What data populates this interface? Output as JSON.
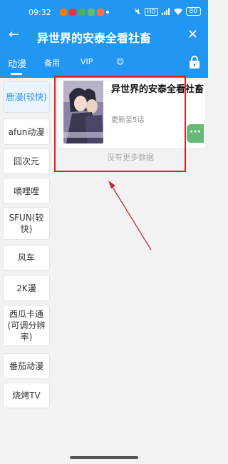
{
  "status_bar": {
    "time": "09:32",
    "battery": "80",
    "hd_label": "HD",
    "app_icon_colors": [
      "#f57c00",
      "#e53935",
      "#4caf50",
      "#66bb6a",
      "#ff7043",
      "#ffffff"
    ]
  },
  "header": {
    "title": "异世界的安泰全看社畜",
    "back_icon": "arrow-left-icon",
    "close_icon": "close-icon"
  },
  "tabs": [
    {
      "label": "动漫",
      "active": true
    },
    {
      "label": "备用",
      "active": false
    },
    {
      "label": "VIP",
      "active": false
    },
    {
      "label": "😊",
      "active": false
    }
  ],
  "sidebar": {
    "items": [
      {
        "label": "鹿漫(较快)",
        "active": true
      },
      {
        "label": "afun动漫",
        "active": false
      },
      {
        "label": "囧次元",
        "active": false
      },
      {
        "label": "嘀哩哩",
        "active": false
      },
      {
        "label": "SFUN(较快)",
        "active": false
      },
      {
        "label": "风车",
        "active": false
      },
      {
        "label": "2K漫",
        "active": false
      },
      {
        "label": "西瓜卡通(可调分辨率)",
        "active": false
      },
      {
        "label": "番茄动漫",
        "active": false
      },
      {
        "label": "烧烤TV",
        "active": false
      }
    ]
  },
  "result": {
    "title": "异世界的安泰全看社畜",
    "subtitle": "更新至5话"
  },
  "no_more_text": "没有更多数据",
  "float_button_label": "···",
  "colors": {
    "primary": "#2196f3",
    "annotation": "#e02020",
    "float_button": "#67b978"
  }
}
